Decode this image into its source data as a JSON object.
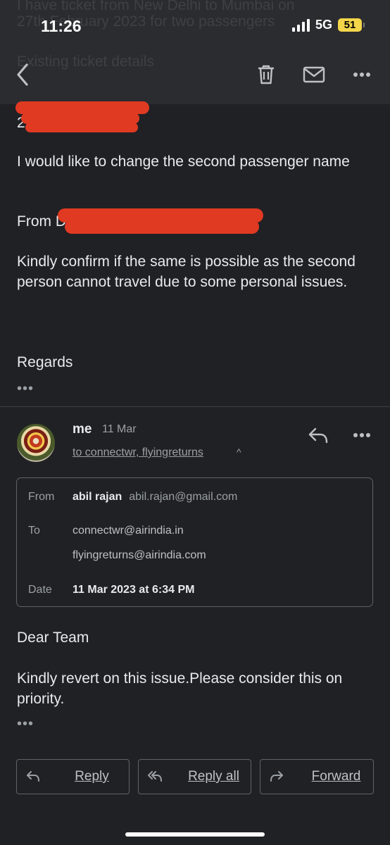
{
  "status": {
    "time": "11:26",
    "network": "5G",
    "battery": "51"
  },
  "background_text": {
    "line1": "I have ticket from New Delhi to Mumbai on",
    "line2": "27th February 2023 for two passengers",
    "line3": "Existing ticket details"
  },
  "toolbar": {
    "back_icon": "chevron-left-icon",
    "delete_icon": "trash-icon",
    "mark_unread_icon": "mail-icon",
    "more_icon": "more-horizontal-icon"
  },
  "first_message": {
    "partial_line": "2",
    "body1": "I would like to change the second passenger name",
    "from_prefix": "From D",
    "body2": "Kindly confirm if the same is possible as the second person cannot travel due to some personal issues.",
    "regards": "Regards",
    "more_dots": "•••"
  },
  "reply_message": {
    "sender": "me",
    "date": "11 Mar",
    "recipients": "to connectwr, flyingreturns",
    "chevron": "^",
    "details": {
      "from_label": "From",
      "from_name": "abil rajan",
      "from_email": "abil.rajan@gmail.com",
      "to_label": "To",
      "to_1": "connectwr@airindia.in",
      "to_2": "flyingreturns@airindia.com",
      "date_label": "Date",
      "date_value": "11 Mar 2023 at 6:34 PM"
    },
    "greeting": "Dear Team",
    "body": "Kindly revert on this issue.Please consider this on priority.",
    "more_dots": "•••"
  },
  "footer": {
    "reply_label": "Reply",
    "reply_all_label": "Reply all",
    "forward_label": "Forward"
  },
  "colors": {
    "background": "#202124",
    "toolbar": "#2b2c2f",
    "redaction": "#e03a22",
    "battery": "#f3d54a"
  }
}
